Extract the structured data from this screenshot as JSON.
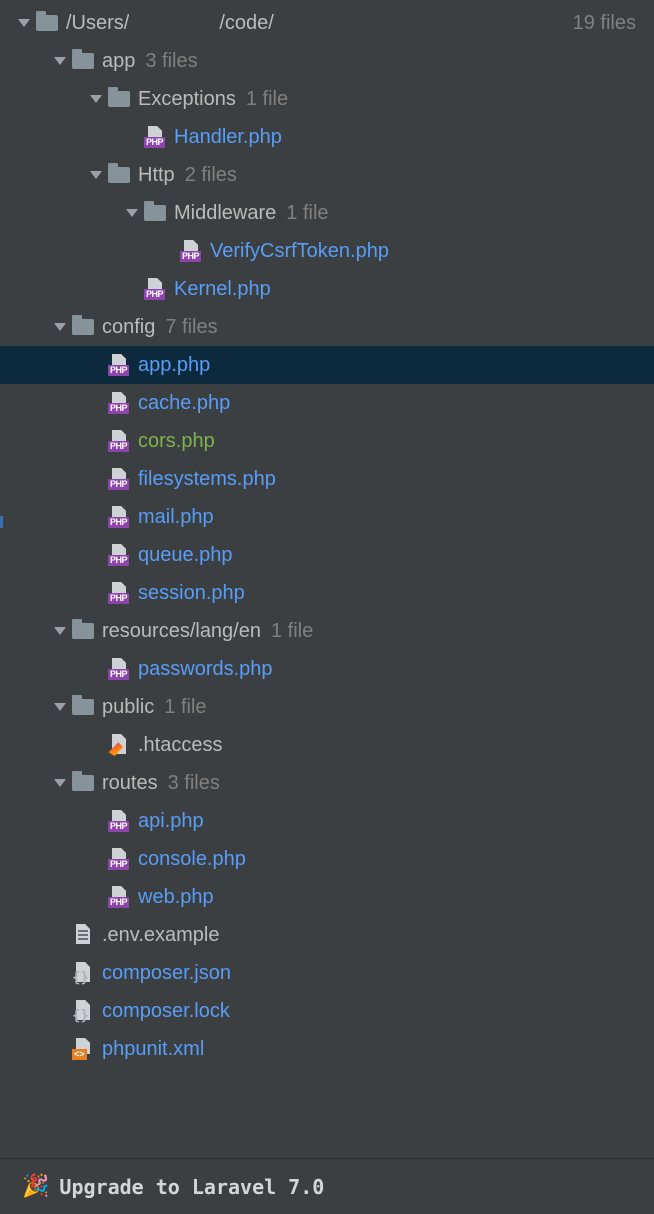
{
  "root": {
    "path_prefix": "/Users/",
    "path_mid": "/code/",
    "count": "19 files"
  },
  "rows": [
    {
      "type": "folder",
      "depth": 1,
      "expanded": true,
      "name": "app",
      "count": "3 files",
      "color": "default"
    },
    {
      "type": "folder",
      "depth": 2,
      "expanded": true,
      "name": "Exceptions",
      "count": "1 file",
      "color": "default"
    },
    {
      "type": "php",
      "depth": 3,
      "name": "Handler.php",
      "color": "blue"
    },
    {
      "type": "folder",
      "depth": 2,
      "expanded": true,
      "name": "Http",
      "count": "2 files",
      "color": "default"
    },
    {
      "type": "folder",
      "depth": 3,
      "expanded": true,
      "name": "Middleware",
      "count": "1 file",
      "color": "default"
    },
    {
      "type": "php",
      "depth": 4,
      "name": "VerifyCsrfToken.php",
      "color": "blue"
    },
    {
      "type": "php",
      "depth": 3,
      "name": "Kernel.php",
      "color": "blue"
    },
    {
      "type": "folder",
      "depth": 1,
      "expanded": true,
      "name": "config",
      "count": "7 files",
      "color": "default"
    },
    {
      "type": "php",
      "depth": 2,
      "name": "app.php",
      "color": "blue",
      "selected": true
    },
    {
      "type": "php",
      "depth": 2,
      "name": "cache.php",
      "color": "blue"
    },
    {
      "type": "php",
      "depth": 2,
      "name": "cors.php",
      "color": "green"
    },
    {
      "type": "php",
      "depth": 2,
      "name": "filesystems.php",
      "color": "blue"
    },
    {
      "type": "php",
      "depth": 2,
      "name": "mail.php",
      "color": "blue"
    },
    {
      "type": "php",
      "depth": 2,
      "name": "queue.php",
      "color": "blue"
    },
    {
      "type": "php",
      "depth": 2,
      "name": "session.php",
      "color": "blue"
    },
    {
      "type": "folder",
      "depth": 1,
      "expanded": true,
      "name": "resources/lang/en",
      "count": "1 file",
      "color": "default"
    },
    {
      "type": "php",
      "depth": 2,
      "name": "passwords.php",
      "color": "blue"
    },
    {
      "type": "folder",
      "depth": 1,
      "expanded": true,
      "name": "public",
      "count": "1 file",
      "color": "default"
    },
    {
      "type": "htaccess",
      "depth": 2,
      "name": ".htaccess",
      "color": "default"
    },
    {
      "type": "folder",
      "depth": 1,
      "expanded": true,
      "name": "routes",
      "count": "3 files",
      "color": "default"
    },
    {
      "type": "php",
      "depth": 2,
      "name": "api.php",
      "color": "blue"
    },
    {
      "type": "php",
      "depth": 2,
      "name": "console.php",
      "color": "blue"
    },
    {
      "type": "php",
      "depth": 2,
      "name": "web.php",
      "color": "blue"
    },
    {
      "type": "txt",
      "depth": 1,
      "name": ".env.example",
      "color": "default"
    },
    {
      "type": "json",
      "depth": 1,
      "name": "composer.json",
      "color": "blue"
    },
    {
      "type": "json",
      "depth": 1,
      "name": "composer.lock",
      "color": "blue"
    },
    {
      "type": "xml",
      "depth": 1,
      "name": "phpunit.xml",
      "color": "blue"
    }
  ],
  "status": {
    "emoji": "🎉",
    "text": "Upgrade to Laravel 7.0"
  },
  "icon_labels": {
    "php": "PHP",
    "xml": "<>"
  }
}
